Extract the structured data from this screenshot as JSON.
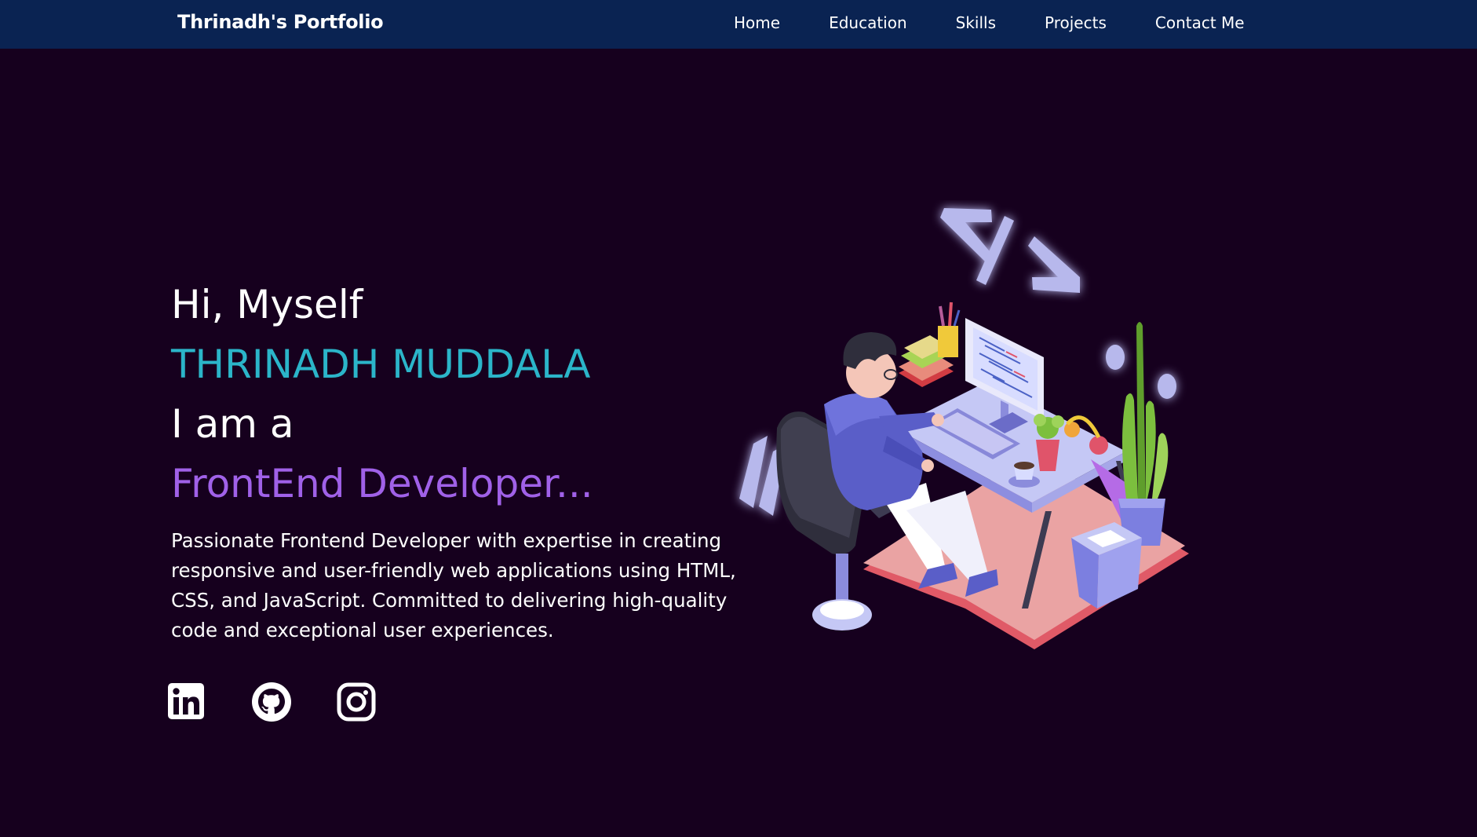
{
  "nav": {
    "brand": "Thrinadh's Portfolio",
    "links": [
      "Home",
      "Education",
      "Skills",
      "Projects",
      "Contact Me"
    ]
  },
  "hero": {
    "greeting": "Hi, Myself",
    "name": "THRINADH MUDDALA",
    "intro": "I am a",
    "role": "FrontEnd Developer...",
    "description": "Passionate Frontend Developer with expertise in creating responsive and user-friendly web applications using HTML, CSS, and JavaScript. Committed to delivering high-quality code and exceptional user experiences."
  },
  "socials": [
    {
      "icon": "linkedin-icon"
    },
    {
      "icon": "github-icon"
    },
    {
      "icon": "instagram-icon"
    }
  ],
  "colors": {
    "background": "#16001e",
    "navbar": "#0a2352",
    "name_accent": "#2bb5c9",
    "role_accent": "#a061e8",
    "text": "#ffffff"
  },
  "illustration": {
    "icon": "developer-at-desk-illustration"
  }
}
